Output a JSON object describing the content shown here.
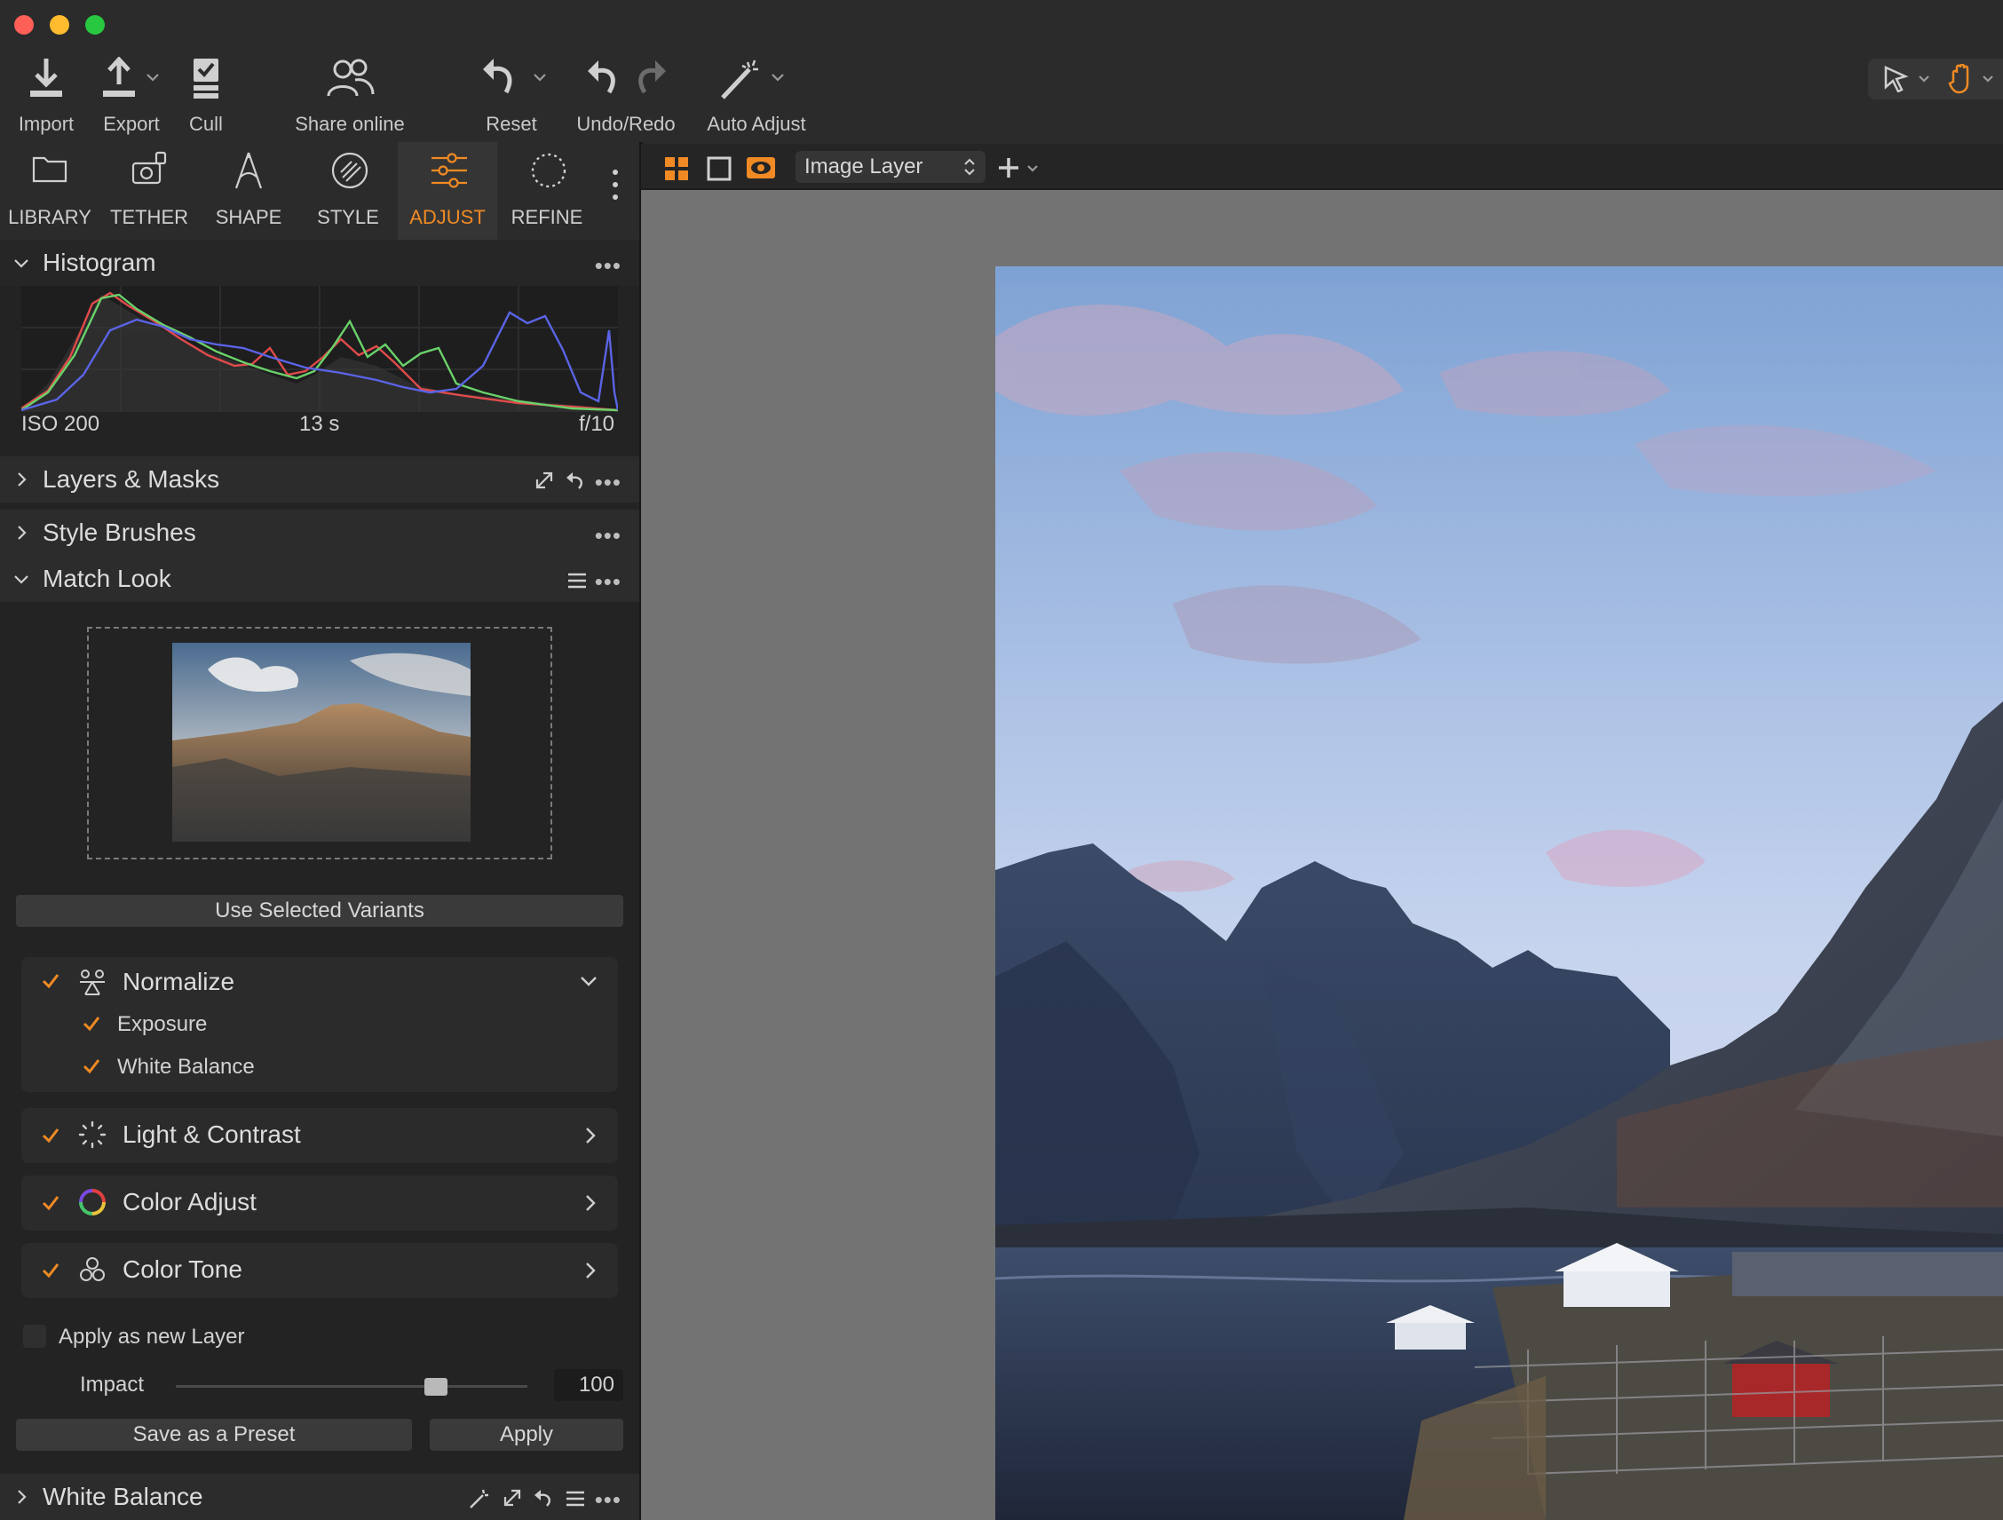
{
  "toolbar": {
    "import_label": "Import",
    "export_label": "Export",
    "cull_label": "Cull",
    "share_label": "Share online",
    "reset_label": "Reset",
    "undo_redo_label": "Undo/Redo",
    "auto_adjust_label": "Auto Adjust"
  },
  "tool_tabs": {
    "library": "LIBRARY",
    "tether": "TETHER",
    "shape": "SHAPE",
    "style": "STYLE",
    "adjust": "ADJUST",
    "refine": "REFINE",
    "active": "ADJUST"
  },
  "viewer": {
    "layer_select": "Image Layer"
  },
  "histogram": {
    "title": "Histogram",
    "iso": "ISO 200",
    "shutter": "13 s",
    "aperture": "f/10"
  },
  "sections": {
    "layers_masks": "Layers & Masks",
    "style_brushes": "Style Brushes",
    "match_look": "Match Look",
    "white_balance": "White Balance"
  },
  "match_look": {
    "use_selected_variants": "Use Selected Variants",
    "normalize": {
      "title": "Normalize",
      "checked": true,
      "exposure": "Exposure",
      "exposure_checked": true,
      "white_balance": "White Balance",
      "white_balance_checked": true
    },
    "light_contrast": {
      "title": "Light & Contrast",
      "checked": true
    },
    "color_adjust": {
      "title": "Color Adjust",
      "checked": true
    },
    "color_tone": {
      "title": "Color Tone",
      "checked": true
    },
    "apply_new_layer": {
      "label": "Apply as new Layer",
      "checked": false
    },
    "impact": {
      "label": "Impact",
      "value": "100",
      "fraction": 0.74
    },
    "save_preset": "Save as a Preset",
    "apply": "Apply"
  },
  "colors": {
    "accent": "#f08a24",
    "panel_bg": "#232323",
    "viewer_bg": "#737373"
  }
}
